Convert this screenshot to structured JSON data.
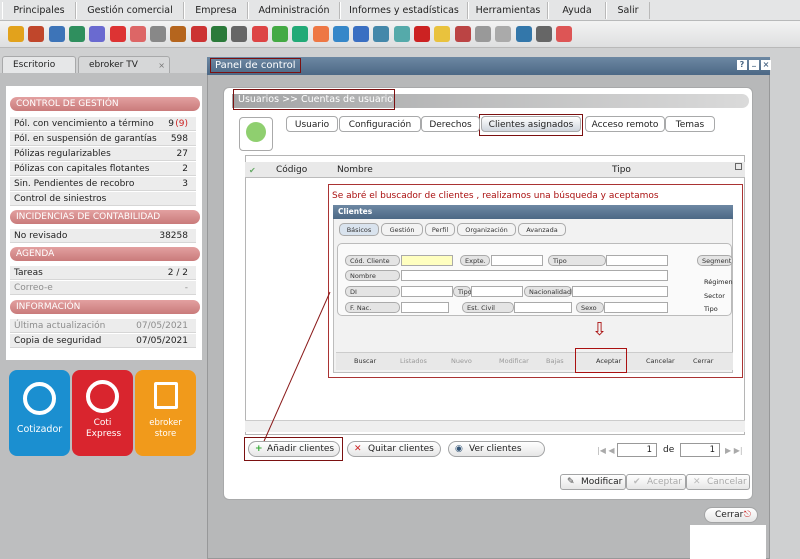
{
  "menu": [
    "Principales",
    "Gestión comercial",
    "Empresa",
    "Administración",
    "Informes y estadísticas",
    "Herramientas",
    "Ayuda",
    "Salir"
  ],
  "toolbar_icons": [
    "users-icon",
    "person-icon",
    "search-icon",
    "card-icon",
    "printer-icon",
    "fire-icon",
    "target-icon",
    "wrench-icon",
    "briefcase-icon",
    "calendar-icon",
    "book-icon",
    "phone-icon",
    "person-red-icon",
    "car-icon",
    "globe-icon",
    "gear-icon",
    "e-icon",
    "diamond-icon",
    "arrow-icon",
    "calendar2-icon",
    "g-icon",
    "bulb-icon",
    "doc-icon",
    "doc2-icon",
    "doc3-icon",
    "phone2-icon",
    "pen-icon",
    "help-icon"
  ],
  "tabs": {
    "escritorio": "Escritorio",
    "ebroker_tv": "ebroker TV"
  },
  "sidebar": {
    "control_head": "CONTROL DE GESTIÓN",
    "control_rows": [
      {
        "label": "Pól. con vencimiento a término",
        "value": "9",
        "extra": "(9)"
      },
      {
        "label": "Pól. en suspensión de garantías",
        "value": "598"
      },
      {
        "label": "Pólizas regularizables",
        "value": "27"
      },
      {
        "label": "Pólizas con capitales flotantes",
        "value": "2"
      },
      {
        "label": "Sin. Pendientes de recobro",
        "value": "3"
      },
      {
        "label": "Control de siniestros",
        "value": ""
      }
    ],
    "incidencias_head": "INCIDENCIAS DE CONTABILIDAD",
    "incidencias_rows": [
      {
        "label": "No revisado",
        "value": "38258"
      }
    ],
    "agenda_head": "AGENDA",
    "agenda_rows": [
      {
        "label": "Tareas",
        "value": "2 / 2"
      },
      {
        "label": "Correo-e",
        "value": "-"
      }
    ],
    "info_head": "INFORMACIÓN",
    "info_rows": [
      {
        "label": "Última actualización",
        "value": "07/05/2021"
      },
      {
        "label": "Copia de seguridad",
        "value": "07/05/2021"
      }
    ]
  },
  "apps": [
    {
      "name": "Cotizador",
      "color": "#1b8fd0"
    },
    {
      "name": "Coti Express",
      "color": "#d9252e"
    },
    {
      "name": "ebroker store",
      "color": "#f19a1b"
    }
  ],
  "panel": {
    "title": "Panel de control",
    "breadcrumb": "Usuarios >> Cuentas de usuario",
    "tabs": [
      "Usuario",
      "Configuración",
      "Derechos",
      "Clientes asignados",
      "Acceso remoto",
      "Temas"
    ],
    "active_tab": "Clientes asignados",
    "columns": [
      "Código",
      "Nombre",
      "Tipo"
    ],
    "annotation": "Se abré el buscador de clientes , realizamos una búsqueda y aceptamos",
    "add_clients": "Añadir clientes",
    "remove_clients": "Quitar clientes",
    "view_clients": "Ver clientes",
    "page": "1",
    "of_label": "de",
    "total_pages": "1",
    "modify": "Modificar",
    "accept": "Aceptar",
    "cancel": "Cancelar",
    "close": "Cerrar"
  },
  "search": {
    "title": "Clientes",
    "tabs": [
      "Básicos",
      "Gestión",
      "Perfil",
      "Organización",
      "Avanzada"
    ],
    "labels": {
      "cod": "Cód. Cliente",
      "expte": "Expte.",
      "tipo": "Tipo",
      "nombre": "Nombre",
      "di": "DI",
      "tipo2": "Tipo",
      "nacionalidad": "Nacionalidad",
      "fnac": "F. Nac.",
      "estcivil": "Est. Civil",
      "sexo": "Sexo",
      "segment": "Segment",
      "regimen": "Régimen",
      "sector": "Sector",
      "tipo3": "Tipo"
    },
    "buttons": [
      "Buscar",
      "Listados",
      "Nuevo",
      "Modificar",
      "Bajas",
      "Aceptar",
      "Cancelar",
      "Cerrar"
    ]
  }
}
